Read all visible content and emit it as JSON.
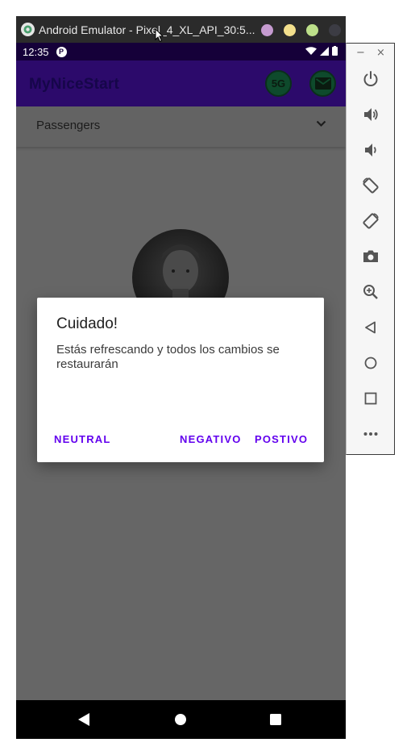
{
  "window": {
    "title": "Android Emulator - Pixel_4_XL_API_30:5...",
    "dot_colors": [
      "#c59bd0",
      "#f3e08d",
      "#bde08a",
      "#3c3c44"
    ]
  },
  "statusbar": {
    "time": "12:35"
  },
  "appbar": {
    "title": "MyNiceStart",
    "action_5g_label": "5G",
    "colors": {
      "bar": "#2c0a6b",
      "action_bg": "#0e4a2c"
    }
  },
  "spinner": {
    "selected": "Passengers"
  },
  "dialog": {
    "title": "Cuidado!",
    "message": "Estás refrescando y todos los cambios se restaurarán",
    "buttons": {
      "neutral": "NEUTRAL",
      "negative": "NEGATIVO",
      "positive": "POSTIVO"
    },
    "accent": "#6200ee"
  },
  "toolbar": {
    "minimize": "−",
    "close": "×",
    "icons": [
      "power-icon",
      "volume-up-icon",
      "volume-down-icon",
      "rotate-left-icon",
      "rotate-right-icon",
      "camera-icon",
      "zoom-in-icon",
      "back-icon",
      "home-icon",
      "overview-icon",
      "more-icon"
    ]
  }
}
